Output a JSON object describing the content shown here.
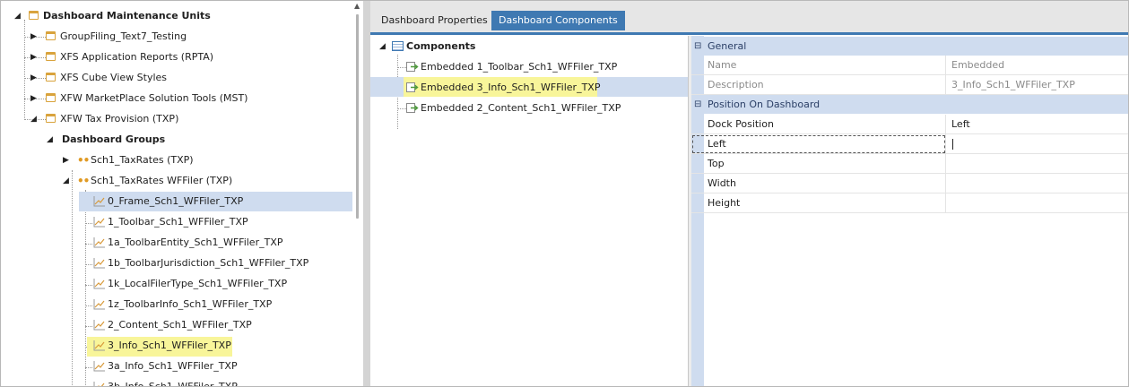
{
  "tree": {
    "root_label": "Dashboard Maintenance Units",
    "items": [
      {
        "label": "GroupFiling_Text7_Testing"
      },
      {
        "label": "XFS Application Reports (RPTA)"
      },
      {
        "label": "XFS Cube View Styles"
      },
      {
        "label": "XFW MarketPlace Solution Tools (MST)"
      },
      {
        "label": "XFW Tax Provision (TXP)"
      }
    ],
    "groups_label": "Dashboard Groups",
    "group_items": [
      {
        "label": "Sch1_TaxRates (TXP)"
      },
      {
        "label": "Sch1_TaxRates WFFiler (TXP)"
      }
    ],
    "dashboards": [
      {
        "label": "0_Frame_Sch1_WFFiler_TXP"
      },
      {
        "label": "1_Toolbar_Sch1_WFFiler_TXP"
      },
      {
        "label": "1a_ToolbarEntity_Sch1_WFFiler_TXP"
      },
      {
        "label": "1b_ToolbarJurisdiction_Sch1_WFFiler_TXP"
      },
      {
        "label": "1k_LocalFilerType_Sch1_WFFiler_TXP"
      },
      {
        "label": "1z_ToolbarInfo_Sch1_WFFiler_TXP"
      },
      {
        "label": "2_Content_Sch1_WFFiler_TXP"
      },
      {
        "label": "3_Info_Sch1_WFFiler_TXP"
      },
      {
        "label": "3a_Info_Sch1_WFFiler_TXP"
      },
      {
        "label": "3b_Info_Sch1_WFFiler_TXP"
      }
    ]
  },
  "tabs": {
    "properties": "Dashboard Properties",
    "components": "Dashboard Components"
  },
  "components": {
    "header": "Components",
    "items": [
      {
        "label": "Embedded 1_Toolbar_Sch1_WFFiler_TXP"
      },
      {
        "label": "Embedded 3_Info_Sch1_WFFiler_TXP"
      },
      {
        "label": "Embedded 2_Content_Sch1_WFFiler_TXP"
      }
    ]
  },
  "properties": {
    "general_label": "General",
    "name_label": "Name",
    "name_value": "Embedded 3_Info_Sch1_WFFiler_TXP",
    "description_label": "Description",
    "description_value": "",
    "position_label": "Position On Dashboard",
    "dock_label": "Dock Position",
    "dock_value": "Left",
    "left_label": "Left",
    "left_value": "",
    "top_label": "Top",
    "top_value": "",
    "width_label": "Width",
    "width_value": "",
    "height_label": "Height",
    "height_value": ""
  },
  "colors": {
    "accent": "#3f79b2",
    "selection": "#cfdcef",
    "highlight": "#f8f59a",
    "folder": "#d9a33c"
  },
  "icons": {
    "folder": "folder-icon",
    "dashboard": "line-chart-icon",
    "group": "group-dots-icon",
    "component": "embedded-component-icon"
  }
}
